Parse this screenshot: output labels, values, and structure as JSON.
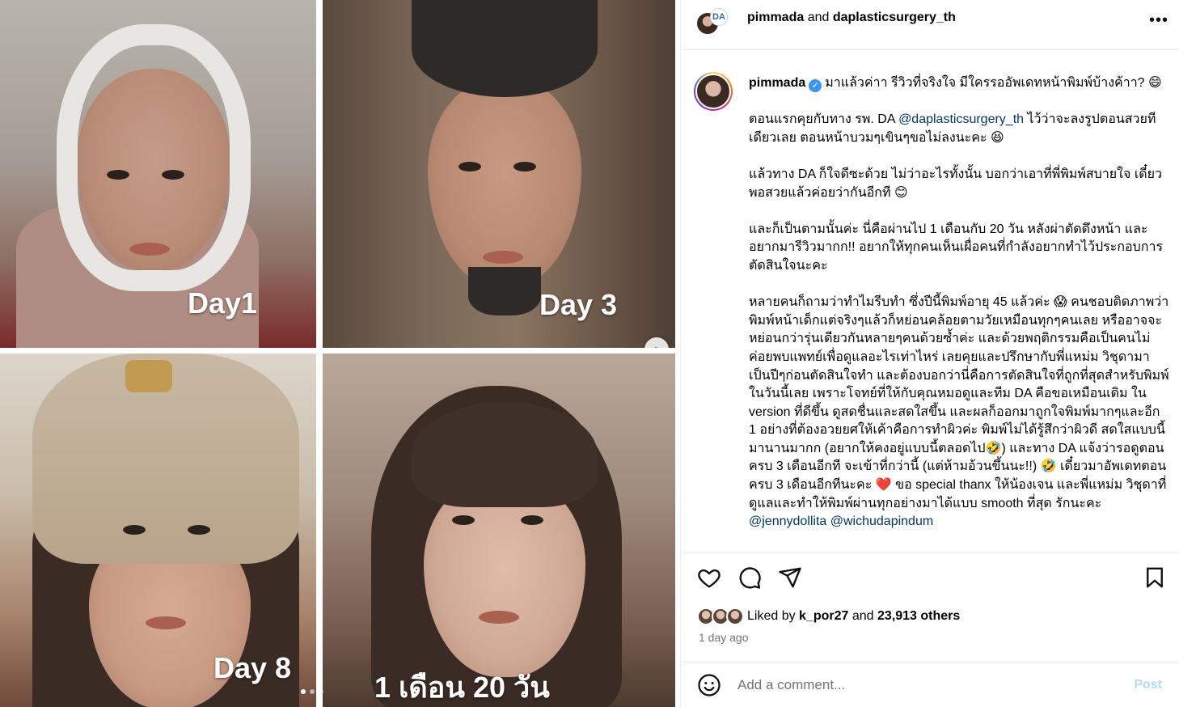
{
  "media": {
    "tiles": [
      {
        "caption": "Day1"
      },
      {
        "caption": "Day 3"
      },
      {
        "caption": "Day 8"
      },
      {
        "caption": "1 เดือน 20 วัน"
      }
    ],
    "next_icon": "chevron-right-icon",
    "carousel_dots": 3,
    "active_dot": 0
  },
  "header": {
    "user": "pimmada",
    "joiner": " and ",
    "collaborator": "daplasticsurgery_th",
    "collab_avatar_text": "DA",
    "more_icon": "more-horizontal-icon"
  },
  "caption": {
    "username": "pimmada",
    "verified": true,
    "first_line": "มาแล้วค่าา รีวิวที่จริงใจ มีใครรออัพเดทหน้าพิมพ์บ้างค้าา? 😄",
    "p2_a": "ตอนแรกคุยกับทาง รพ. DA ",
    "p2_mention": "@daplasticsurgery_th",
    "p2_b": " ไว้ว่าจะลงรูปตอนสวยทีเดียวเลย ตอนหน้าบวมๆเขินๆขอไม่ลงนะคะ 😆",
    "p3": "แล้วทาง DA ก็ใจดีซะด้วย ไม่ว่าอะไรทั้งนั้น บอกว่าเอาที่พี่พิมพ์สบายใจ เดี๋ยวพอสวยแล้วค่อยว่ากันอีกที 😊",
    "p4": "และก็เป็นตามนั้นค่ะ นี่คือผ่านไป 1 เดือนกับ 20 วัน หลังผ่าตัดดึงหน้า และอยากมารีวิวมากก!! อยากให้ทุกคนเห็นเผื่อคนที่กำลังอยากทำไว้ประกอบการตัดสินใจนะคะ",
    "p5_a": "หลายคนก็ถามว่าทำไมรีบทำ ซึ่งปีนี้พิมพ์อายุ 45 แล้วค่ะ 😱 คนชอบติดภาพว่าพิมพ์หน้าเด็กแต่จริงๆแล้วก็หย่อนคล้อยตามวัยเหมือนทุกๆคนเลย หรืออาจจะหย่อนกว่ารุ่นเดียวกันหลายๆคนด้วยซ้ำค่ะ และด้วยพฤติกรรมคือเป็นคนไม่ค่อยพบแพทย์เพื่อดูแลอะไรเท่าไหร่ เลยคุยและปรึกษากับพี่แหม่ม วิชุดามาเป็นปีๆก่อนตัดสินใจทำ และต้องบอกว่านี่คือการตัดสินใจที่ถูกที่สุดสำหรับพิมพ์ในวันนี้เลย เพราะโจทย์ที่ให้กับคุณหมอดูและทีม DA คือขอเหมือนเดิม ใน version ที่ดีขึ้น ดูสดชื่นและสดใสขึ้น และผลก็ออกมาถูกใจพิมพ์มากๆและอีก 1 อย่างที่ต้องอวยยศให้เค้าคือการทำผิวค่ะ พิมพ์ไม่ได้รู้สึกว่าผิวดี สดใสแบบนี้มานานมากก (อยากให้คงอยู่แบบนี้ตลอดไป🤣) และทาง DA แจ้งว่ารอดูตอนครบ 3 เดือนอีกที จะเข้าที่กว่านี้ (แต่ห้ามอ้วนขึ้นนะ!!) 🤣 เดี๋ยวมาอัพเดทตอนครบ 3 เดือนอีกทีนะคะ ❤️ ขอ special thanx ให้น้องเจน และพี่แหม่ม วิชุดาที่ดูแลและทำให้พิมพ์ผ่านทุกอย่างมาได้แบบ smooth ที่สุด รักนะคะ ",
    "p5_m1": "@jennydollita",
    "p5_m2": "@wichudapindum"
  },
  "actions": {
    "like_icon": "heart-icon",
    "comment_icon": "comment-icon",
    "share_icon": "send-icon",
    "save_icon": "bookmark-icon"
  },
  "likes": {
    "prefix": "Liked by ",
    "liker": "k_por27",
    "middle": " and ",
    "others": "23,913 others"
  },
  "timestamp": "1 day ago",
  "comment": {
    "placeholder": "Add a comment...",
    "post_label": "Post",
    "emoji_icon": "smiley-icon"
  }
}
